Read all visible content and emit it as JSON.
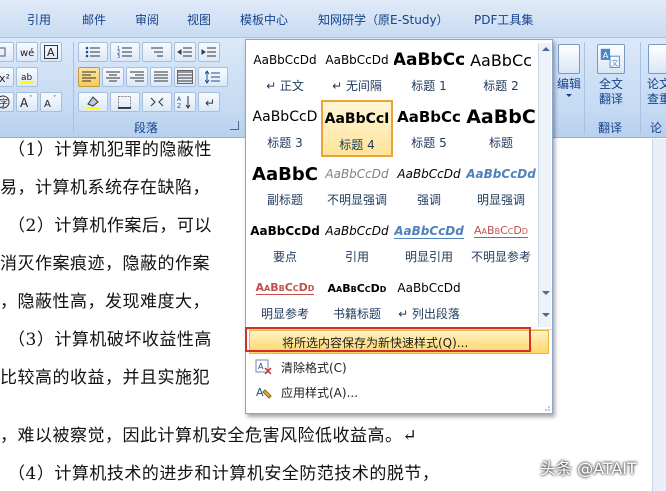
{
  "menubar": {
    "items": [
      "引用",
      "邮件",
      "审阅",
      "视图",
      "模板中心",
      "知网研学（原E-Study）",
      "PDF工具集"
    ]
  },
  "ribbon": {
    "paragraph_group_label": "段落",
    "translate_group_label": "翻译",
    "edit_label": "编辑",
    "fulltext_translate_label": "全文\n翻译",
    "fulltext_translate_line1": "全文",
    "fulltext_translate_line2": "翻译",
    "partial_labels": [
      "论文",
      "查重"
    ],
    "partial_group_label": "论文"
  },
  "gallery": {
    "styles": [
      {
        "sample": "AaBbCcDd",
        "name": "↵ 正文",
        "style": "normal"
      },
      {
        "sample": "AaBbCcDd",
        "name": "↵ 无间隔",
        "style": "normal"
      },
      {
        "sample": "AaBbCc",
        "name": "标题 1",
        "style": "h1"
      },
      {
        "sample": "AaBbCc",
        "name": "标题 2",
        "style": "h2"
      },
      {
        "sample": "AaBbCcD",
        "name": "标题 3",
        "style": "h3"
      },
      {
        "sample": "AaBbCcI",
        "name": "标题 4",
        "style": "h4",
        "selected": true
      },
      {
        "sample": "AaBbCc",
        "name": "标题 5",
        "style": "h5"
      },
      {
        "sample": "AaBbC",
        "name": "标题",
        "style": "title"
      },
      {
        "sample": "AaBbC",
        "name": "副标题",
        "style": "subtitle"
      },
      {
        "sample": "AaBbCcDd",
        "name": "不明显强调",
        "style": "subtle"
      },
      {
        "sample": "AaBbCcDd",
        "name": "强调",
        "style": "emph"
      },
      {
        "sample": "AaBbCcDd",
        "name": "明显强调",
        "style": "intense"
      },
      {
        "sample": "AaBbCcDd",
        "name": "要点",
        "style": "strong"
      },
      {
        "sample": "AaBbCcDd",
        "name": "引用",
        "style": "quote"
      },
      {
        "sample": "AaBbCcDd",
        "name": "明显引用",
        "style": "iquote"
      },
      {
        "sample": "AaBbCcDd",
        "name": "不明显参考",
        "style": "sref"
      },
      {
        "sample": "AaBbCcDd",
        "name": "明显参考",
        "style": "iref"
      },
      {
        "sample": "AaBbCcDd",
        "name": "书籍标题",
        "style": "book"
      },
      {
        "sample": "AaBbCcDd",
        "name": "↵ 列出段落",
        "style": "list"
      }
    ],
    "menu": {
      "save_selection": "将所选内容保存为新快速样式(Q)...",
      "clear_format": "清除格式(C)",
      "apply_styles": "应用样式(A)..."
    }
  },
  "document": {
    "lines": [
      "（1）计算机犯罪的隐蔽性",
      "易，计算机系统存在缺陷，",
      "（2）计算机作案后，可以",
      "消灭作案痕迹，隐蔽的作案",
      "，隐蔽性高，发现难度大，",
      "（3）计算机破坏收益性高",
      "比较高的收益，并且实施犯",
      "，难以被察觉，因此计算机安全危害风险低收益高。↵",
      "（4）计算机技术的进步和计算机安全防范技术的脱节，"
    ]
  },
  "watermark": "头条 @ATAIT",
  "colors": {
    "ribbon_bg": "#c6daf3",
    "selection_orange": "#e8a33b",
    "highlight_red": "#d0312a",
    "heading_blue": "#17365d"
  }
}
